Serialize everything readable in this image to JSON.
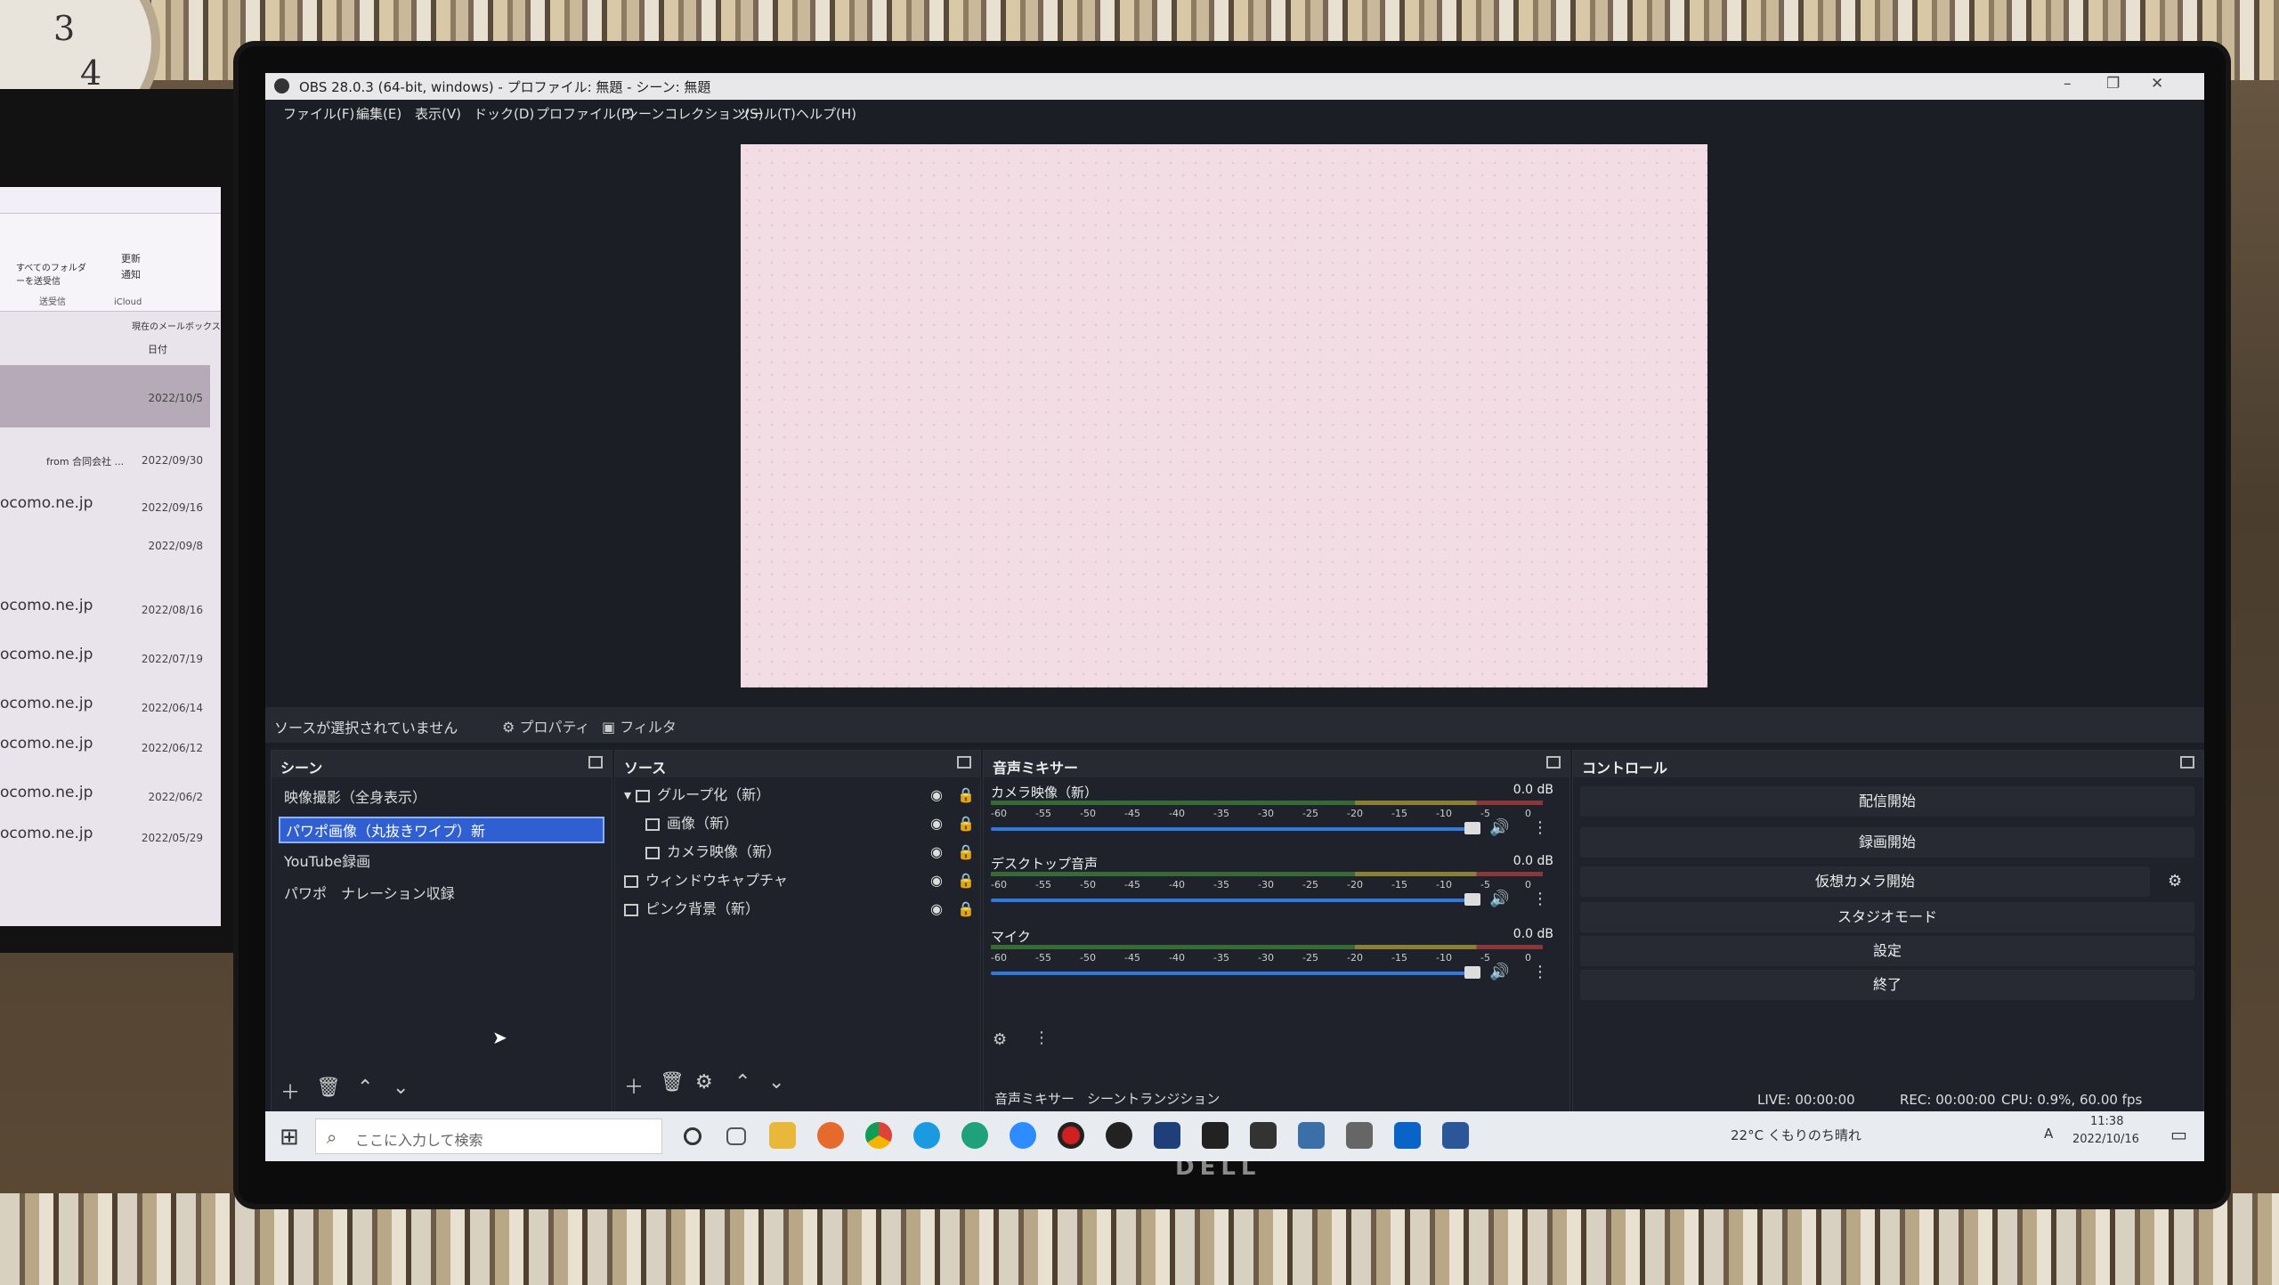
{
  "left_monitor": {
    "ribbon_labels": [
      "すべてのフォルダーを送受信",
      "更新",
      "通知",
      "送受信",
      "iCloud"
    ],
    "search_placeholder": "現在のメールボックス",
    "sort_label": "日付",
    "rows": [
      {
        "text": "",
        "date": "2022/10/5"
      },
      {
        "text": "from 合同会社 ...",
        "date": "2022/09/30"
      },
      {
        "text": "ocomo.ne.jp",
        "date": "2022/09/16"
      },
      {
        "text": "",
        "date": "2022/09/8"
      },
      {
        "text": "ocomo.ne.jp",
        "date": "2022/08/16"
      },
      {
        "text": "ocomo.ne.jp",
        "date": "2022/07/19"
      },
      {
        "text": "ocomo.ne.jp",
        "date": "2022/06/14"
      },
      {
        "text": "ocomo.ne.jp",
        "date": "2022/06/12"
      },
      {
        "text": "ocomo.ne.jp",
        "date": "2022/06/2"
      },
      {
        "text": "ocomo.ne.jp",
        "date": "2022/05/29"
      }
    ]
  },
  "obs": {
    "title": "OBS 28.0.3 (64-bit, windows) - プロファイル: 無題 - シーン: 無題",
    "menu": [
      "ファイル(F)",
      "編集(E)",
      "表示(V)",
      "ドック(D)",
      "プロファイル(P)",
      "シーンコレクション(S)",
      "ツール(T)",
      "ヘルプ(H)"
    ],
    "source_bar": {
      "no_source": "ソースが選択されていません",
      "properties": "プロパティ",
      "filters": "フィルタ"
    },
    "scenes": {
      "title": "シーン",
      "items": [
        "映像撮影（全身表示）",
        "パワポ画像（丸抜きワイプ）新",
        "YouTube録画",
        "パワポ　ナレーション収録"
      ],
      "selected_index": 1
    },
    "sources": {
      "title": "ソース",
      "items": [
        "グループ化（新）",
        "画像（新）",
        "カメラ映像（新）",
        "ウィンドウキャプチャ",
        "ピンク背景（新）"
      ]
    },
    "mixer": {
      "title": "音声ミキサー",
      "tracks": [
        {
          "name": "カメラ映像（新）",
          "db": "0.0 dB"
        },
        {
          "name": "デスクトップ音声",
          "db": "0.0 dB"
        },
        {
          "name": "マイク",
          "db": "0.0 dB"
        }
      ],
      "ticks": [
        "-60",
        "-55",
        "-50",
        "-45",
        "-40",
        "-35",
        "-30",
        "-25",
        "-20",
        "-15",
        "-10",
        "-5",
        "0"
      ],
      "tabs": [
        "音声ミキサー",
        "シーントランジション"
      ]
    },
    "controls": {
      "title": "コントロール",
      "buttons": [
        "配信開始",
        "録画開始",
        "仮想カメラ開始",
        "スタジオモード",
        "設定",
        "終了"
      ]
    },
    "status": {
      "live": "LIVE: 00:00:00",
      "rec": "REC: 00:00:00",
      "cpu": "CPU: 0.9%, 60.00 fps"
    }
  },
  "taskbar": {
    "search_placeholder": "ここに入力して検索",
    "weather": "22°C くもりのち晴れ",
    "time": "11:38",
    "date": "2022/10/16",
    "ime": "A"
  },
  "monitor_brand": "DELL"
}
